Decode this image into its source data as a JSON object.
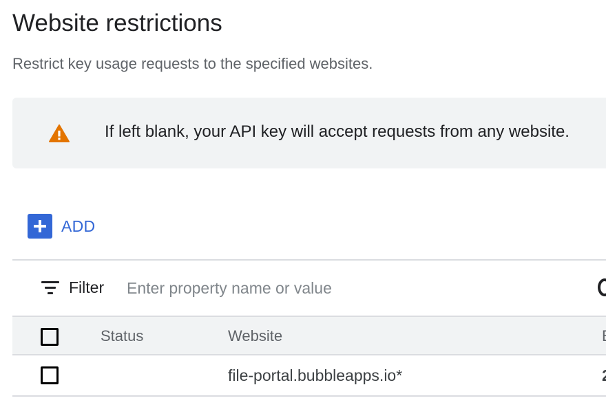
{
  "header": {
    "title": "Website restrictions",
    "subtitle": "Restrict key usage requests to the specified websites."
  },
  "warning": {
    "icon": "warning-icon",
    "icon_color": "#e37400",
    "text": "If left blank, your API key will accept requests from any website."
  },
  "add_button": {
    "label": "ADD",
    "icon": "plus-icon",
    "color": "#3367d6"
  },
  "filter": {
    "label": "Filter",
    "icon": "filter-list-icon",
    "placeholder": "Enter property name or value",
    "value": ""
  },
  "table": {
    "columns": [
      "Status",
      "Website",
      "E"
    ],
    "rows": [
      {
        "status": "",
        "website": "file-portal.bubbleapps.io*",
        "clipped_value": "2"
      }
    ]
  }
}
